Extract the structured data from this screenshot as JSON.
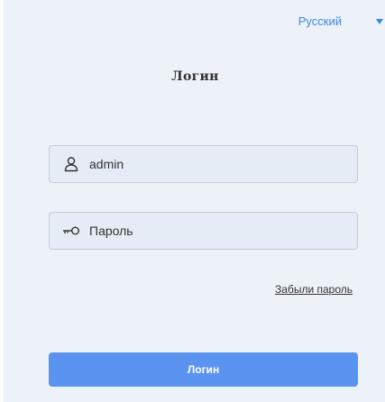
{
  "language": {
    "selected": "Русский",
    "icon": "chevron-down-icon"
  },
  "login": {
    "title": "Логин",
    "username": {
      "value": "admin",
      "icon": "user-icon"
    },
    "password": {
      "placeholder": "Пароль",
      "icon": "key-icon"
    },
    "forgot_label": "Забыли пароль",
    "submit_label": "Логин"
  },
  "colors": {
    "accent": "#3b88e6",
    "button": "#5b93f0",
    "panel": "#edf1f8"
  }
}
